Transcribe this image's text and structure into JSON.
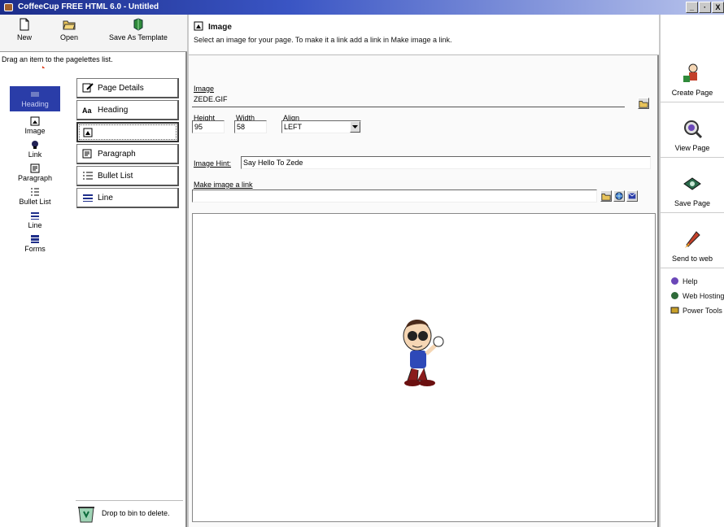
{
  "window": {
    "title": "CoffeeCup FREE HTML 6.0 - Untitled",
    "controls": [
      "_",
      "·",
      "X"
    ]
  },
  "toolbar": {
    "new": "New",
    "open": "Open",
    "save_template": "Save As Template"
  },
  "left": {
    "hint": "Drag an item to the pagelettes list.",
    "items": [
      {
        "label": "Heading",
        "icon": "heading-icon"
      },
      {
        "label": "Image",
        "icon": "image-icon"
      },
      {
        "label": "Link",
        "icon": "link-icon"
      },
      {
        "label": "Paragraph",
        "icon": "paragraph-icon"
      },
      {
        "label": "Bullet List",
        "icon": "bullet-list-icon"
      },
      {
        "label": "Line",
        "icon": "line-icon"
      },
      {
        "label": "Forms",
        "icon": "forms-icon"
      }
    ],
    "pagelettes": [
      "Page Details",
      "Heading",
      "",
      "Paragraph",
      "Bullet List",
      "Line"
    ],
    "bin": "Drop to bin to delete."
  },
  "editor": {
    "title": "Image",
    "description": "Select an image for your page. To make it a link add a link in Make image a link.",
    "image_label": "Image",
    "image_value": "ZEDE.GIF",
    "height_label": "Height",
    "height_value": "95",
    "width_label": "Width",
    "width_value": "58",
    "align_label": "Align",
    "align_value": "LEFT",
    "hint_label": "Image Hint:",
    "hint_value": "Say Hello To Zede",
    "link_label": "Make image a link",
    "link_value": ""
  },
  "right": {
    "create": "Create Page",
    "view": "View Page",
    "save": "Save Page",
    "send": "Send to web",
    "help": "Help",
    "hosting": "Web Hosting",
    "tools": "Power Tools"
  },
  "colors": {
    "titlebar": "#1c2d8a",
    "selection": "#2a3da8",
    "accent_arrow": "#e0401e"
  }
}
